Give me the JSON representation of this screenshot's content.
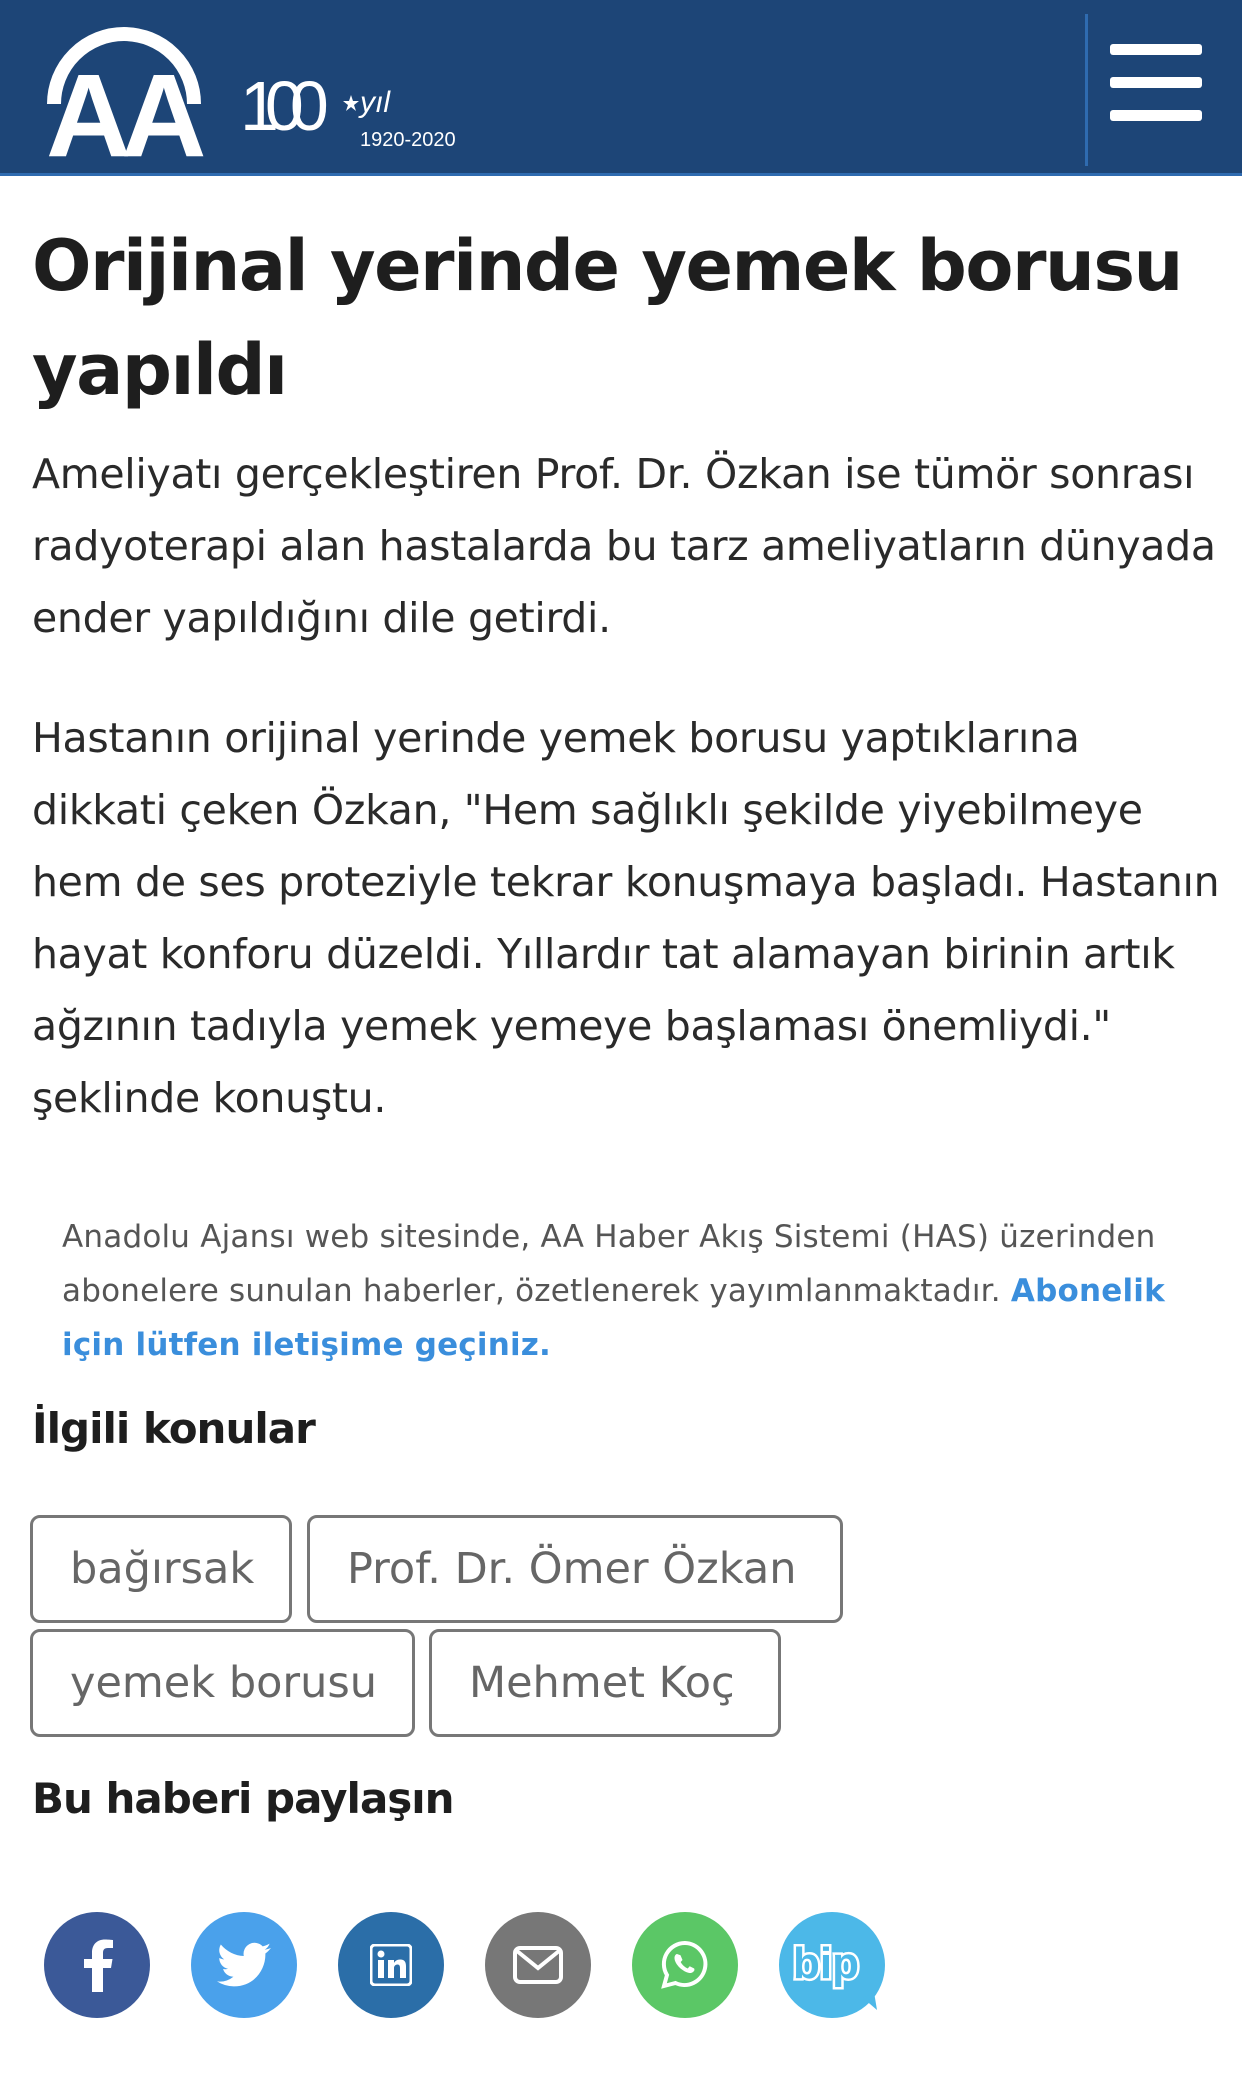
{
  "header": {
    "logo_text": "AA",
    "anniversary_number": "100",
    "anniversary_word": "yıl",
    "anniversary_years": "1920-2020",
    "brand_color": "#1d4577"
  },
  "article": {
    "title": "Orijinal yerinde yemek borusu yapıldı",
    "paragraphs": [
      "Ameliyatı gerçekleştiren Prof. Dr. Özkan ise tümör sonrası radyoterapi alan hastalarda bu tarz ameliyatların dünyada ender yapıldığını dile getirdi.",
      "Hastanın orijinal yerinde yemek borusu yaptıklarına dikkati çeken Özkan, \"Hem sağlıklı şekilde yiyebilmeye hem de ses proteziyle tekrar konuşmaya başladı. Hastanın hayat konforu düzeldi. Yıllardır tat alamayan birinin artık ağzının tadıyla yemek yemeye başlaması önemliydi.\" şeklinde konuştu."
    ]
  },
  "notice": {
    "text": "Anadolu Ajansı web sitesinde, AA Haber Akış Sistemi (HAS) üzerinden abonelere sunulan haberler, özetlenerek yayımlanmaktadır. ",
    "link": "Abonelik için lütfen iletişime geçiniz."
  },
  "related": {
    "heading": "İlgili konular",
    "tags": [
      "bağırsak",
      "Prof. Dr. Ömer Özkan",
      "yemek borusu",
      "Mehmet Koç"
    ]
  },
  "share": {
    "heading": "Bu haberi paylaşın",
    "buttons": [
      {
        "name": "facebook",
        "icon": "facebook-icon",
        "color": "#3b5998"
      },
      {
        "name": "twitter",
        "icon": "twitter-icon",
        "color": "#4aa1eb"
      },
      {
        "name": "linkedin",
        "icon": "linkedin-icon",
        "color": "#2b6ea8"
      },
      {
        "name": "email",
        "icon": "envelope-icon",
        "color": "#777777"
      },
      {
        "name": "whatsapp",
        "icon": "whatsapp-icon",
        "color": "#5bc766"
      },
      {
        "name": "bip",
        "icon": "bip-icon",
        "color": "#4cb8e8"
      }
    ]
  }
}
